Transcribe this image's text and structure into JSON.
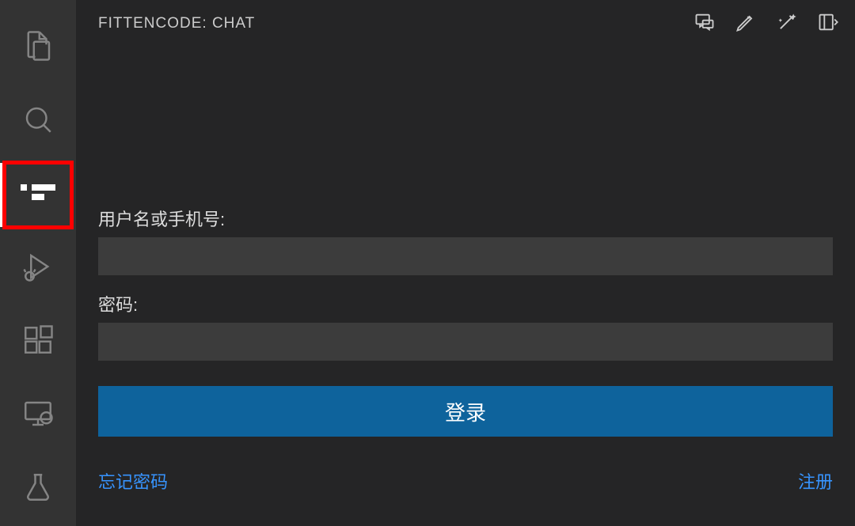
{
  "panel": {
    "title": "FITTENCODE: CHAT"
  },
  "form": {
    "username_label": "用户名或手机号:",
    "password_label": "密码:",
    "login_button": "登录",
    "forgot_password": "忘记密码",
    "register": "注册"
  }
}
